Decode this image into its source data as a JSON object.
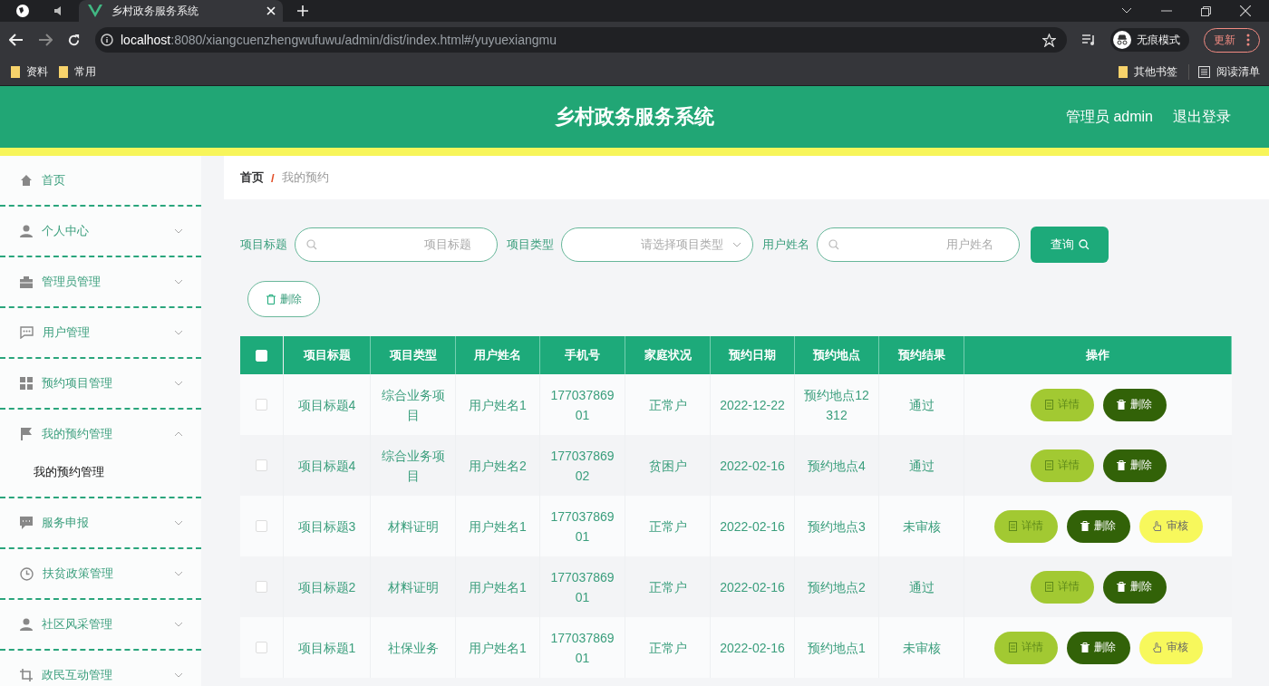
{
  "browser": {
    "tab_title": "乡村政务服务系统",
    "url_host": "localhost",
    "url_path": ":8080/xiangcuenzhengwufuwu/admin/dist/index.html#/yuyuexiangmu",
    "profile": "无痕模式",
    "update": "更新",
    "bookmarks": [
      "资料",
      "常用"
    ],
    "bookmarks_right": [
      "其他书签",
      "阅读清单"
    ]
  },
  "header": {
    "title": "乡村政务服务系统",
    "user": "管理员 admin",
    "logout": "退出登录"
  },
  "sidebar": {
    "items": [
      {
        "kind": "link",
        "label": "首页"
      },
      {
        "kind": "group",
        "label": "个人中心",
        "expanded": false
      },
      {
        "kind": "group",
        "label": "管理员管理",
        "expanded": false
      },
      {
        "kind": "group",
        "label": "用户管理",
        "expanded": false
      },
      {
        "kind": "group",
        "label": "预约项目管理",
        "expanded": false
      },
      {
        "kind": "group",
        "label": "我的预约管理",
        "expanded": true,
        "children": [
          {
            "label": "我的预约管理",
            "selected": true
          }
        ]
      },
      {
        "kind": "group",
        "label": "服务申报",
        "expanded": false
      },
      {
        "kind": "group",
        "label": "扶贫政策管理",
        "expanded": false
      },
      {
        "kind": "group",
        "label": "社区风采管理",
        "expanded": false
      },
      {
        "kind": "group",
        "label": "政民互动管理",
        "expanded": false
      }
    ]
  },
  "breadcrumb": {
    "items": [
      "首页",
      "我的预约"
    ],
    "separator": "/"
  },
  "search": {
    "fields": [
      {
        "kind": "text",
        "label": "项目标题",
        "placeholder": "项目标题"
      },
      {
        "kind": "select",
        "label": "项目类型",
        "placeholder": "请选择项目类型"
      },
      {
        "kind": "text",
        "label": "用户姓名",
        "placeholder": "用户姓名"
      }
    ],
    "button": "查询",
    "delete_button": "删除"
  },
  "table": {
    "select_all": {
      "checked": false
    },
    "columns": [
      "项目标题",
      "项目类型",
      "用户姓名",
      "手机号",
      "家庭状况",
      "预约日期",
      "预约地点",
      "预约结果",
      "操作"
    ],
    "rows": [
      {
        "checked": false,
        "cells": [
          "项目标题4",
          "综合业务项目",
          "用户姓名1",
          "17703786901",
          "正常户",
          "2022-12-22",
          "预约地点12312",
          "通过"
        ],
        "actions": [
          {
            "kind": "detail",
            "label": "详情"
          },
          {
            "kind": "delete",
            "label": "删除"
          }
        ]
      },
      {
        "checked": false,
        "cells": [
          "项目标题4",
          "综合业务项目",
          "用户姓名2",
          "17703786902",
          "贫困户",
          "2022-02-16",
          "预约地点4",
          "通过"
        ],
        "actions": [
          {
            "kind": "detail",
            "label": "详情"
          },
          {
            "kind": "delete",
            "label": "删除"
          }
        ]
      },
      {
        "checked": false,
        "cells": [
          "项目标题3",
          "材料证明",
          "用户姓名1",
          "17703786901",
          "正常户",
          "2022-02-16",
          "预约地点3",
          "未审核"
        ],
        "actions": [
          {
            "kind": "detail",
            "label": "详情"
          },
          {
            "kind": "delete",
            "label": "删除"
          },
          {
            "kind": "review",
            "label": "审核"
          }
        ]
      },
      {
        "checked": false,
        "cells": [
          "项目标题2",
          "材料证明",
          "用户姓名1",
          "17703786901",
          "正常户",
          "2022-02-16",
          "预约地点2",
          "通过"
        ],
        "actions": [
          {
            "kind": "detail",
            "label": "详情"
          },
          {
            "kind": "delete",
            "label": "删除"
          }
        ]
      },
      {
        "checked": false,
        "cells": [
          "项目标题1",
          "社保业务",
          "用户姓名1",
          "17703786901",
          "正常户",
          "2022-02-16",
          "预约地点1",
          "未审核"
        ],
        "actions": [
          {
            "kind": "detail",
            "label": "详情"
          },
          {
            "kind": "delete",
            "label": "删除"
          },
          {
            "kind": "review",
            "label": "审核"
          }
        ]
      }
    ]
  }
}
